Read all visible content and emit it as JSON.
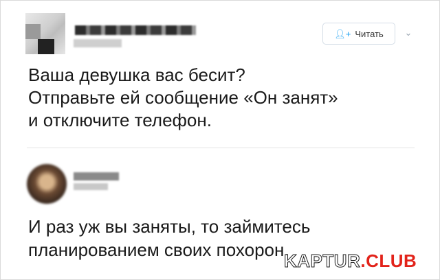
{
  "tweet1": {
    "follow_label": "Читать",
    "follow_icon": "person-plus-icon",
    "menu_icon": "chevron-down-icon",
    "lines": [
      "Ваша девушка вас бесит?",
      "Отправьте ей сообщение «Он занят»",
      "и отключите телефон."
    ]
  },
  "tweet2": {
    "lines": [
      "И раз уж вы заняты, то займитесь",
      "планированием своих похорон."
    ]
  },
  "watermark": {
    "part1": "KAPTUR",
    "part2": ".CLUB",
    "accent_color": "#e2231a"
  },
  "colors": {
    "link_blue": "#1da1f2",
    "text": "#1a1a1a",
    "divider": "#e3e3e3"
  }
}
